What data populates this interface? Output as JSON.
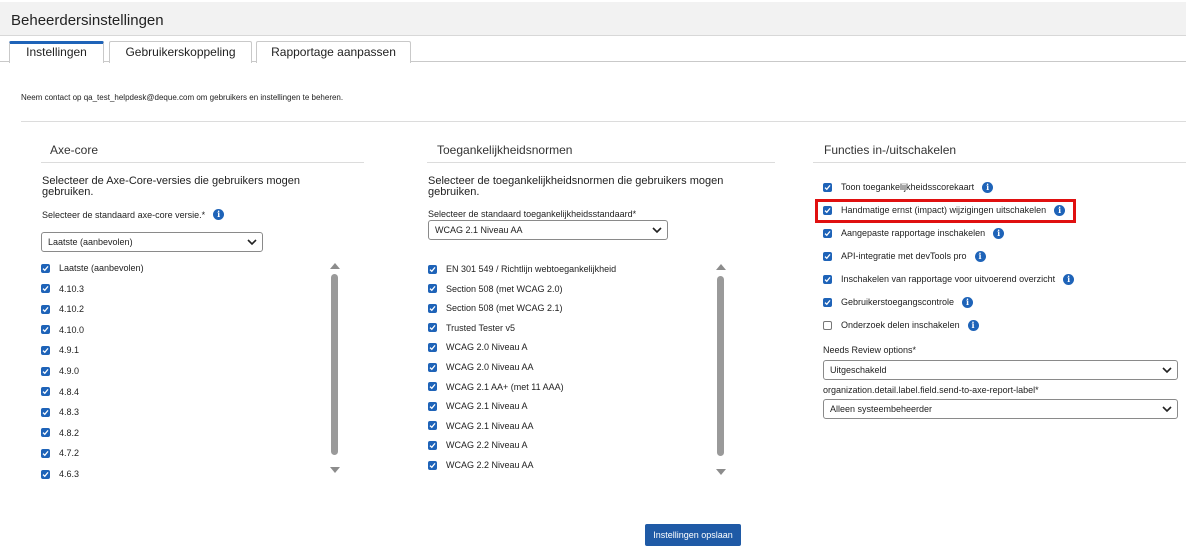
{
  "window": {
    "title": "Beheerdersinstellingen"
  },
  "tabs": [
    {
      "label": "Instellingen"
    },
    {
      "label": "Gebruikerskoppeling"
    },
    {
      "label": "Rapportage aanpassen"
    }
  ],
  "intro": "Neem contact op qa_test_helpdesk@deque.com om gebruikers en instellingen te beheren.",
  "axe": {
    "title": "Axe-core",
    "desc_line1": "Selecteer de Axe-Core-versies die gebruikers mogen",
    "desc_line2": "gebruiken.",
    "default_label": "Selecteer de standaard axe-core versie.*",
    "default_value": "Laatste (aanbevolen)",
    "versions": [
      "Laatste (aanbevolen)",
      "4.10.3",
      "4.10.2",
      "4.10.0",
      "4.9.1",
      "4.9.0",
      "4.8.4",
      "4.8.3",
      "4.8.2",
      "4.7.2",
      "4.6.3"
    ]
  },
  "standards": {
    "title": "Toegankelijkheidsnormen",
    "desc_line1": "Selecteer de toegankelijkheidsnormen die gebruikers mogen",
    "desc_line2": "gebruiken.",
    "default_label": "Selecteer de standaard toegankelijkheidsstandaard*",
    "default_value": "WCAG 2.1 Niveau AA",
    "items": [
      "EN 301 549 / Richtlijn webtoegankelijkheid",
      "Section 508 (met WCAG 2.0)",
      "Section 508 (met WCAG 2.1)",
      "Trusted Tester v5",
      "WCAG 2.0 Niveau A",
      "WCAG 2.0 Niveau AA",
      "WCAG 2.1 AA+ (met 11 AAA)",
      "WCAG 2.1 Niveau A",
      "WCAG 2.1 Niveau AA",
      "WCAG 2.2 Niveau A",
      "WCAG 2.2 Niveau AA"
    ]
  },
  "features": {
    "title": "Functies in-/uitschakelen",
    "items": [
      {
        "label": "Toon toegankelijkheidsscorekaart",
        "checked": true,
        "info": true
      },
      {
        "label": "Handmatige ernst (impact) wijzigingen uitschakelen",
        "checked": true,
        "info": true
      },
      {
        "label": "Aangepaste rapportage inschakelen",
        "checked": true,
        "info": true
      },
      {
        "label": "API-integratie met devTools pro",
        "checked": true,
        "info": true
      },
      {
        "label": "Inschakelen van rapportage voor uitvoerend overzicht",
        "checked": true,
        "info": true
      },
      {
        "label": "Gebruikerstoegangscontrole",
        "checked": true,
        "info": true
      },
      {
        "label": "Onderzoek delen inschakelen",
        "checked": false,
        "info": true
      }
    ],
    "needs_review_label": "Needs Review options*",
    "needs_review_value": "Uitgeschakeld",
    "send_report_label": "organization.detail.label.field.send-to-axe-report-label*",
    "send_report_value": "Alleen systeembeheerder"
  },
  "save_label": "Instellingen opslaan",
  "colors": {
    "accent": "#1e63b8",
    "highlight": "#e01010",
    "button": "#1f5aa6"
  }
}
